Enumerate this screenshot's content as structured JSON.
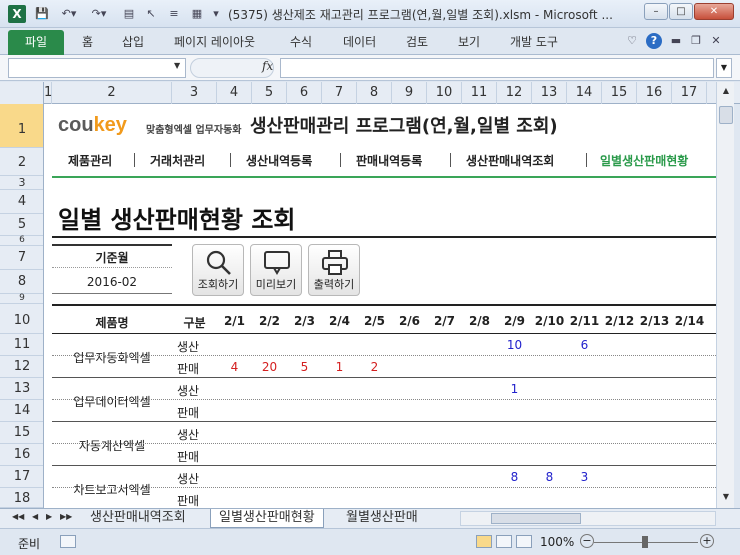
{
  "window": {
    "title": "(5375) 생산제조 재고관리 프로그램(연,월,일별 조회).xlsm  -  Microsoft ...",
    "app_icon": "X",
    "controls": [
      "–",
      "□",
      "✕"
    ]
  },
  "ribbon": {
    "file_tab": "파일",
    "tabs": [
      "홈",
      "삽입",
      "페이지 레이아웃",
      "수식",
      "데이터",
      "검토",
      "보기",
      "개발 도구"
    ]
  },
  "formula_bar": {
    "fx": "fx",
    "name_box": "",
    "content": ""
  },
  "columns": [
    "1",
    "2",
    "3",
    "4",
    "5",
    "6",
    "7",
    "8",
    "9",
    "10",
    "11",
    "12",
    "13",
    "14",
    "15",
    "16",
    "17"
  ],
  "rows": [
    "1",
    "2",
    "3",
    "4",
    "5",
    "6",
    "7",
    "8",
    "9",
    "10",
    "11",
    "12",
    "13",
    "14",
    "15",
    "16",
    "17",
    "18"
  ],
  "header": {
    "logo_main": "cou",
    "logo_key": "key",
    "logo_sub": "맞춤형엑셀 업무자동화",
    "title": "생산판매관리 프로그램(연,월,일별 조회)"
  },
  "menu": [
    "제품관리",
    "거래처관리",
    "생산내역등록",
    "판매내역등록",
    "생산판매내역조회",
    "일별생산판매현황"
  ],
  "page_title": "일별 생산판매현황 조회",
  "criteria": {
    "label": "기준월",
    "value": "2016-02"
  },
  "buttons": {
    "search": "조회하기",
    "preview": "미리보기",
    "print": "출력하기"
  },
  "table": {
    "col_product": "제품명",
    "col_kind": "구분",
    "dates": [
      "2/1",
      "2/2",
      "2/3",
      "2/4",
      "2/5",
      "2/6",
      "2/7",
      "2/8",
      "2/9",
      "2/10",
      "2/11",
      "2/12",
      "2/13",
      "2/14"
    ],
    "kind_produce": "생산",
    "kind_sale": "판매",
    "products": [
      {
        "name": "업무자동화엑셀",
        "produce": [
          "",
          "",
          "",
          "",
          "",
          "",
          "",
          "",
          "10",
          "",
          "6",
          "",
          "",
          ""
        ],
        "sale": [
          "4",
          "20",
          "5",
          "1",
          "2",
          "",
          "",
          "",
          "",
          "",
          "",
          "",
          "",
          ""
        ]
      },
      {
        "name": "업무데이터엑셀",
        "produce": [
          "",
          "",
          "",
          "",
          "",
          "",
          "",
          "",
          "1",
          "",
          "",
          "",
          "",
          ""
        ],
        "sale": [
          "",
          "",
          "",
          "",
          "",
          "",
          "",
          "",
          "",
          "",
          "",
          "",
          "",
          ""
        ]
      },
      {
        "name": "자동계산엑셀",
        "produce": [
          "",
          "",
          "",
          "",
          "",
          "",
          "",
          "",
          "",
          "",
          "",
          "",
          "",
          ""
        ],
        "sale": [
          "",
          "",
          "",
          "",
          "",
          "",
          "",
          "",
          "",
          "",
          "",
          "",
          "",
          ""
        ]
      },
      {
        "name": "차트보고서엑셀",
        "produce": [
          "",
          "",
          "",
          "",
          "",
          "",
          "",
          "",
          "8",
          "8",
          "3",
          "",
          "",
          ""
        ],
        "sale": [
          "",
          "",
          "",
          "",
          "",
          "",
          "",
          "",
          "",
          "",
          "",
          "",
          "",
          ""
        ]
      }
    ]
  },
  "sheet_tabs": {
    "left": "생산판매내역조회",
    "active": "일별생산판매현황",
    "right": "월별생산판매"
  },
  "status": {
    "ready": "준비",
    "zoom": "100%"
  },
  "colors": {
    "produce": "#2222cc",
    "sale": "#d42020",
    "accent": "#3aa558",
    "logo_key": "#f19a1c"
  }
}
